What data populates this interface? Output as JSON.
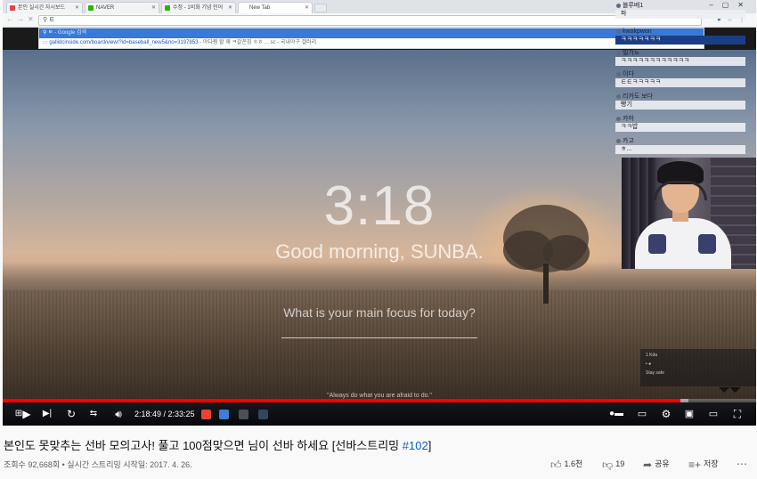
{
  "browser": {
    "tabs": [
      {
        "label": "본인 실시간 자시보드",
        "color": "#e8453c"
      },
      {
        "label": "NAVER",
        "color": "#2db400"
      },
      {
        "label": "수정 - 1비화 기념 인어",
        "color": "#2db400"
      },
      {
        "label": "New Tab",
        "color": "#9aa0a6"
      }
    ],
    "address_value": "ㅌ",
    "suggestion_query": "ㅌ",
    "suggestion_hint": "- Google 검색",
    "suggestion_url": "gallidcinside.com/board/view/?id=baseball_new5&no=3197853",
    "suggestion_url_tail": "- 야다찡 할 꽤 ㅋ갈꼰짐 ㅎㅎ ... sc - 국내야구 갤러리"
  },
  "momentum": {
    "time": "3:18",
    "greeting": "Good morning, SUNBA.",
    "focus_question": "What is your main focus for today?",
    "quote": "\"Always do what you are afraid to do.\""
  },
  "chat": [
    {
      "user": "블루베1",
      "text": "파"
    },
    {
      "user": "kwakpwon",
      "text": "ㅋㅋㅋㅋㅋㅋㅋ"
    },
    {
      "user": "빌가도",
      "text": "ㅋㅋㅋㅋㅋㅋㅋㅋㅋㅋㅋㅋ"
    },
    {
      "user": "이다",
      "text": "ㅌㅌㅋㅋㅋㅋㅋ"
    },
    {
      "user": "리카도 보다",
      "text": "빵기"
    },
    {
      "user": "카마",
      "text": "ㅋㅋ밥"
    },
    {
      "user": "카고",
      "text": "ㅎ..."
    }
  ],
  "player": {
    "time_label": "2:18:49 / 2:33:25",
    "played_fraction": 0.9,
    "buffered_fraction": 0.91,
    "mini_box_lines": [
      "1 Kda",
      "• ●",
      "Stay safe"
    ]
  },
  "video": {
    "title_main": "본인도 못맞추는 선바 모의고사! 풀고 100점맞으면 님이 선바 하세요 [선바스트리밍 ",
    "title_tag": "#102",
    "title_end": "]",
    "meta": "조회수 92,668회 • 실시간 스트리밍 시작일: 2017. 4. 26.",
    "likes": "1.6천",
    "dislikes": "19",
    "share_label": "공유",
    "save_label": "저장"
  }
}
